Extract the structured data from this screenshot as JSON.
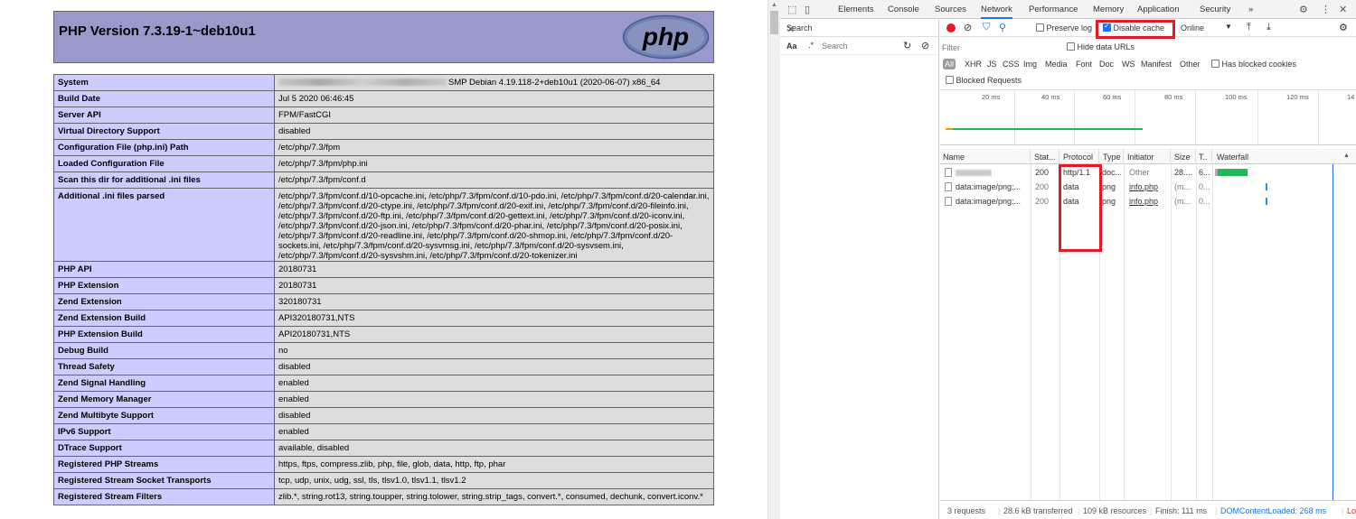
{
  "php": {
    "title": "PHP Version 7.3.19-1~deb10u1",
    "logo_text": "php",
    "rows": [
      {
        "key": "System",
        "value": "SMP Debian 4.19.118-2+deb10u1 (2020-06-07) x86_64"
      },
      {
        "key": "Build Date",
        "value": "Jul 5 2020 06:46:45"
      },
      {
        "key": "Server API",
        "value": "FPM/FastCGI"
      },
      {
        "key": "Virtual Directory Support",
        "value": "disabled"
      },
      {
        "key": "Configuration File (php.ini) Path",
        "value": "/etc/php/7.3/fpm"
      },
      {
        "key": "Loaded Configuration File",
        "value": "/etc/php/7.3/fpm/php.ini"
      },
      {
        "key": "Scan this dir for additional .ini files",
        "value": "/etc/php/7.3/fpm/conf.d"
      },
      {
        "key": "Additional .ini files parsed",
        "value": "/etc/php/7.3/fpm/conf.d/10-opcache.ini, /etc/php/7.3/fpm/conf.d/10-pdo.ini, /etc/php/7.3/fpm/conf.d/20-calendar.ini, /etc/php/7.3/fpm/conf.d/20-ctype.ini, /etc/php/7.3/fpm/conf.d/20-exif.ini, /etc/php/7.3/fpm/conf.d/20-fileinfo.ini, /etc/php/7.3/fpm/conf.d/20-ftp.ini, /etc/php/7.3/fpm/conf.d/20-gettext.ini, /etc/php/7.3/fpm/conf.d/20-iconv.ini, /etc/php/7.3/fpm/conf.d/20-json.ini, /etc/php/7.3/fpm/conf.d/20-phar.ini, /etc/php/7.3/fpm/conf.d/20-posix.ini, /etc/php/7.3/fpm/conf.d/20-readline.ini, /etc/php/7.3/fpm/conf.d/20-shmop.ini, /etc/php/7.3/fpm/conf.d/20-sockets.ini, /etc/php/7.3/fpm/conf.d/20-sysvmsg.ini, /etc/php/7.3/fpm/conf.d/20-sysvsem.ini, /etc/php/7.3/fpm/conf.d/20-sysvshm.ini, /etc/php/7.3/fpm/conf.d/20-tokenizer.ini"
      },
      {
        "key": "PHP API",
        "value": "20180731"
      },
      {
        "key": "PHP Extension",
        "value": "20180731"
      },
      {
        "key": "Zend Extension",
        "value": "320180731"
      },
      {
        "key": "Zend Extension Build",
        "value": "API320180731,NTS"
      },
      {
        "key": "PHP Extension Build",
        "value": "API20180731,NTS"
      },
      {
        "key": "Debug Build",
        "value": "no"
      },
      {
        "key": "Thread Safety",
        "value": "disabled"
      },
      {
        "key": "Zend Signal Handling",
        "value": "enabled"
      },
      {
        "key": "Zend Memory Manager",
        "value": "enabled"
      },
      {
        "key": "Zend Multibyte Support",
        "value": "disabled"
      },
      {
        "key": "IPv6 Support",
        "value": "enabled"
      },
      {
        "key": "DTrace Support",
        "value": "available, disabled"
      },
      {
        "key": "Registered PHP Streams",
        "value": "https, ftps, compress.zlib, php, file, glob, data, http, ftp, phar"
      },
      {
        "key": "Registered Stream Socket Transports",
        "value": "tcp, udp, unix, udg, ssl, tls, tlsv1.0, tlsv1.1, tlsv1.2"
      },
      {
        "key": "Registered Stream Filters",
        "value": "zlib.*, string.rot13, string.toupper, string.tolower, string.strip_tags, convert.*, consumed, dechunk, convert.iconv.*"
      }
    ]
  },
  "devtools": {
    "tabs": [
      "Elements",
      "Console",
      "Sources",
      "Network",
      "Performance",
      "Memory",
      "Application",
      "Security"
    ],
    "more": "»",
    "search_title": "Search",
    "search_case": "Aa",
    "search_regex": ".*",
    "search_placeholder": "Search",
    "toolbar": {
      "preserve_log": "Preserve log",
      "disable_cache": "Disable cache",
      "throttle": "Online"
    },
    "filter_placeholder": "Filter",
    "hide_data_urls": "Hide data URLs",
    "types": [
      "All",
      "XHR",
      "JS",
      "CSS",
      "Img",
      "Media",
      "Font",
      "Doc",
      "WS",
      "Manifest",
      "Other"
    ],
    "has_blocked_cookies": "Has blocked cookies",
    "blocked_requests": "Blocked Requests",
    "timeline_ticks": [
      "20 ms",
      "40 ms",
      "60 ms",
      "80 ms",
      "100 ms",
      "120 ms",
      "14"
    ],
    "columns": [
      "Name",
      "Stat...",
      "Protocol",
      "Type",
      "Initiator",
      "Size",
      "T..",
      "Waterfall"
    ],
    "requests": [
      {
        "name": "",
        "status": "200",
        "protocol": "http/1.1",
        "type": "doc...",
        "initiator": "Other",
        "size": "28....",
        "time": "6..."
      },
      {
        "name": "data:image/png;...",
        "status": "200",
        "protocol": "data",
        "type": "png",
        "initiator": "info.php",
        "size": "(m...",
        "time": "0..."
      },
      {
        "name": "data:image/png;...",
        "status": "200",
        "protocol": "data",
        "type": "png",
        "initiator": "info.php",
        "size": "(m...",
        "time": "0..."
      }
    ],
    "status": {
      "requests": "3 requests",
      "transferred": "28.6 kB transferred",
      "resources": "109 kB resources",
      "finish": "Finish: 111 ms",
      "dcl": "DOMContentLoaded: 268 ms",
      "load": "Lo"
    },
    "colors": {
      "accent": "#1a73e8",
      "highlight": "#e01b24",
      "waterfall_bar": "#1db954"
    }
  }
}
